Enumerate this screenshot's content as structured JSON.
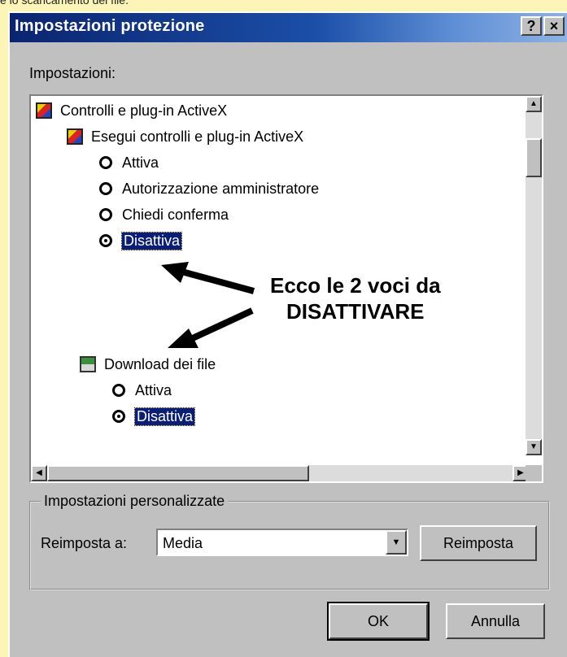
{
  "top_note": "e lo scaricamento dei file.",
  "dialog": {
    "title": "Impostazioni protezione",
    "help_button": "?",
    "close_button": "×",
    "settings_label": "Impostazioni:",
    "tree": {
      "group1_label": "Controlli e plug-in ActiveX",
      "group1_child_label": "Esegui controlli e plug-in ActiveX",
      "group1_options": [
        "Attiva",
        "Autorizzazione amministratore",
        "Chiedi conferma",
        "Disattiva"
      ],
      "group1_selected": "Disattiva",
      "group2_label": "Download dei file",
      "group2_options": [
        "Attiva",
        "Disattiva"
      ],
      "group2_selected": "Disattiva"
    },
    "annotation": {
      "line1": "Ecco le 2 voci da",
      "line2": "DISATTIVARE"
    },
    "custom_group": {
      "legend": "Impostazioni personalizzate",
      "reset_label": "Reimposta a:",
      "reset_value": "Media",
      "reset_button": "Reimposta"
    },
    "ok_button": "OK",
    "cancel_button": "Annulla"
  },
  "icons": {
    "activex": "activex-icon",
    "download": "download-icon",
    "help": "help-icon",
    "close": "close-icon"
  },
  "colors": {
    "selection": "#0a1e78",
    "title_bar_start": "#0a2470",
    "background": "#fdf5b8",
    "dialog_face": "#c0c0c0"
  }
}
